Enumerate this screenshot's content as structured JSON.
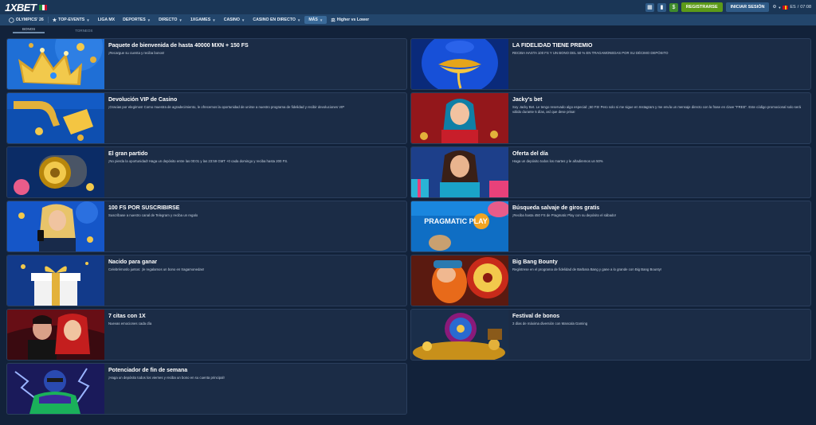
{
  "brand": {
    "logo": "1XBET",
    "flag_colors": [
      "#1f8b3a",
      "#ffffff",
      "#c8102e"
    ]
  },
  "header": {
    "register_label": "REGISTRARSE",
    "login_label": "INICIAR SESIÓN",
    "language": "ES",
    "time": "07:08",
    "colors": {
      "register": "#5c9a18",
      "accent": "#1a3656"
    }
  },
  "nav": {
    "items": [
      {
        "label": "OLYMPICS' 26"
      },
      {
        "label": "TOP-EVENTS"
      },
      {
        "label": "LIGA MX"
      },
      {
        "label": "DEPORTES"
      },
      {
        "label": "DIRECTO"
      },
      {
        "label": "1XGAMES"
      },
      {
        "label": "CASINO"
      },
      {
        "label": "CASINO EN DIRECTO"
      },
      {
        "label": "MÁS"
      },
      {
        "label": "Higher vs Lower"
      }
    ]
  },
  "subtabs": [
    {
      "label": "BONOS"
    },
    {
      "label": "TORNEOS"
    }
  ],
  "promos": [
    {
      "title": "Paquete de bienvenida de hasta 40000 MXN + 150 FS",
      "desc": "¡Recargue su cuenta y reciba bonos!",
      "thumb": "crown"
    },
    {
      "title": "LA FIDELIDAD TIENE PREMIO",
      "desc": "RECIBA HASTA 100 FS Y UN BONO DEL 50 % EN TRAGAMONEDAS POR SU DÉCIMO DEPÓSITO",
      "thumb": "lips"
    },
    {
      "title": "Devolución VIP de Casino",
      "desc": "¡Gracias por elegirnos! Como muestra de agradecimiento, le ofrecemos la oportunidad de unirse a nuestro programa de fidelidad y recibir devoluciones VIP",
      "thumb": "golden-tap"
    },
    {
      "title": "Jacky's bet",
      "desc": "Soy Jacky Bet. Le tengo reservado algo especial: ¡50 FS! Pero solo si me sigue en Instagram y me envía un mensaje directo con la frase en clave \"FREE\". Este código promocional solo será válido durante 5 días, así que dese prisa!",
      "thumb": "jacky"
    },
    {
      "title": "El gran partido",
      "desc": "¡No pierda la oportunidad! Haga un depósito entre las 00:01 y las 23:59 GMT +0 cada domingo y reciba hasta 200 FS.",
      "thumb": "cannon"
    },
    {
      "title": "Oferta del día",
      "desc": "Haga un depósito todos los martes y le añadiremos un 50%",
      "thumb": "gift-woman"
    },
    {
      "title": "100 FS POR SUSCRIBIRSE",
      "desc": "Suscríbase a nuestro canal de Telegram y reciba un regalo",
      "thumb": "phone-woman"
    },
    {
      "title": "Búsqueda salvaje de giros gratis",
      "desc": "¡Reciba hasta 450 FS de Pragmatic Play con su depósito el sábado!",
      "thumb": "pragmatic"
    },
    {
      "title": "Nacido para ganar",
      "desc": "Celebrémoslo juntos: ¡le regalamos un bono en tragamonedas!",
      "thumb": "gift-box"
    },
    {
      "title": "Big Bang Bounty",
      "desc": "Regístrese en el programa de fidelidad de Barbara Bang y gane a lo grande con Big Bang Bounty!",
      "thumb": "dwarf"
    },
    {
      "title": "7 citas con 1X",
      "desc": "Nuevas emociones cada día",
      "thumb": "couple"
    },
    {
      "title": "Festival de bonos",
      "desc": "3 días de máxima diversión con Mancala Gaming",
      "thumb": "wheel"
    },
    {
      "title": "Potenciador de fin de semana",
      "desc": "¡Haga un depósito todos los viernes y reciba un bono en su cuenta principal!",
      "thumb": "hero"
    }
  ],
  "pragmatic_logo": "PRAGMATIC PLAY"
}
